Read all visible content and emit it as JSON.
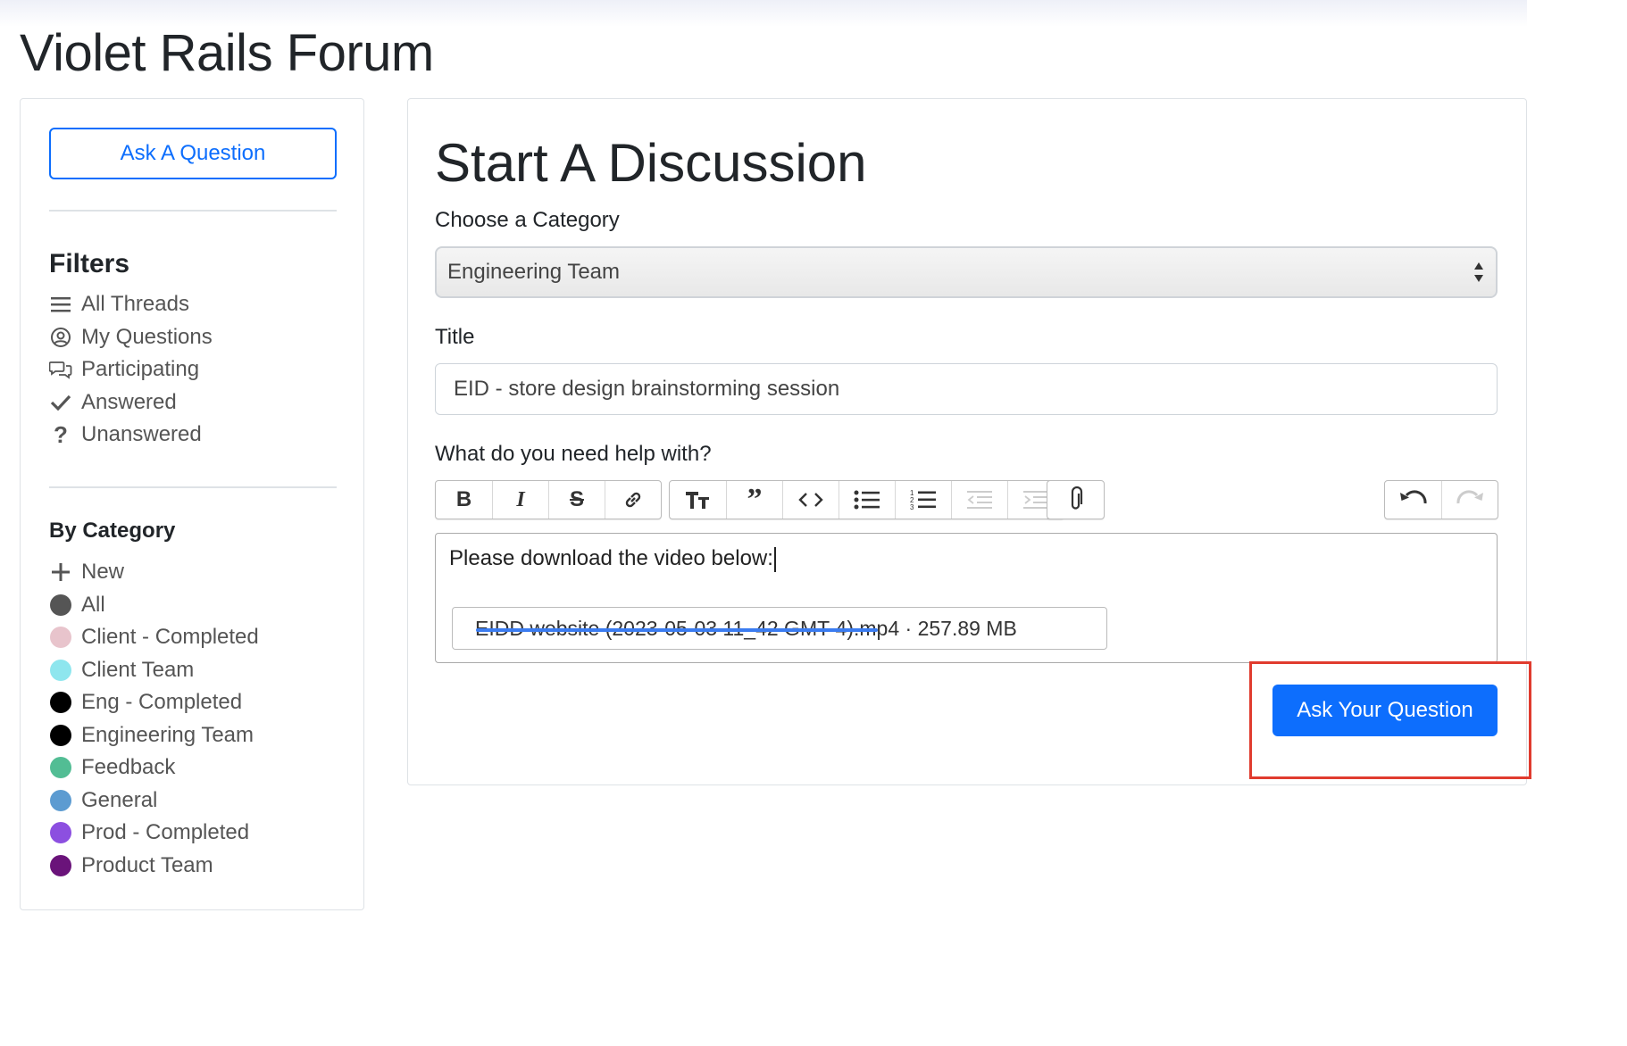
{
  "header": {
    "title": "Violet Rails Forum"
  },
  "sidebar": {
    "ask_button_label": "Ask A Question",
    "filters_heading": "Filters",
    "filters": [
      {
        "label": "All Threads",
        "icon": "list-icon"
      },
      {
        "label": "My Questions",
        "icon": "user-circle-icon"
      },
      {
        "label": "Participating",
        "icon": "chat-bubbles-icon"
      },
      {
        "label": "Answered",
        "icon": "checkmark-icon"
      },
      {
        "label": "Unanswered",
        "icon": "question-mark-icon"
      }
    ],
    "category_heading": "By Category",
    "categories": [
      {
        "label": "New",
        "icon": "plus-icon"
      },
      {
        "label": "All",
        "color": "#555555"
      },
      {
        "label": "Client - Completed",
        "color": "#e8c4cc"
      },
      {
        "label": "Client Team",
        "color": "#8ee6ee"
      },
      {
        "label": "Eng - Completed",
        "color": "#000000"
      },
      {
        "label": "Engineering Team",
        "color": "#000000"
      },
      {
        "label": "Feedback",
        "color": "#52bd94"
      },
      {
        "label": "General",
        "color": "#5c9bd1"
      },
      {
        "label": "Prod - Completed",
        "color": "#8c4fe0"
      },
      {
        "label": "Product Team",
        "color": "#6a137a"
      }
    ]
  },
  "main": {
    "title": "Start A Discussion",
    "category_label": "Choose a Category",
    "category_value": "Engineering Team",
    "title_label": "Title",
    "title_value": "EID - store design brainstorming session",
    "body_label": "What do you need help with?",
    "toolbar": [
      "bold-icon",
      "italic-icon",
      "strikethrough-icon",
      "link-icon",
      "heading-icon",
      "quote-icon",
      "code-icon",
      "bullet-list-icon",
      "numbered-list-icon",
      "decrease-indent-icon",
      "increase-indent-icon",
      "attach-icon",
      "undo-icon",
      "redo-icon"
    ],
    "body_text": "Please download the video below:",
    "attachment_text": "EIDD website (2023-05-03 11_42 GMT-4).mp4 · 257.89 MB",
    "submit_label": "Ask Your Question"
  },
  "colors": {
    "accent": "#0d6efd",
    "highlight": "#e03b2e"
  }
}
